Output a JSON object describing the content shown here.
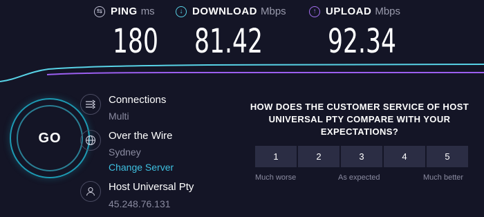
{
  "metrics": {
    "ping": {
      "name": "PING",
      "unit": "ms",
      "value": "180",
      "icon": "ping-icon",
      "color": "#bdbdd0"
    },
    "download": {
      "name": "DOWNLOAD",
      "unit": "Mbps",
      "value": "81.42",
      "icon": "download-arrow-icon",
      "color": "#58d2e6"
    },
    "upload": {
      "name": "UPLOAD",
      "unit": "Mbps",
      "value": "92.34",
      "icon": "upload-arrow-icon",
      "color": "#a46ff0"
    }
  },
  "graph": {
    "download_color": "#58d2e6",
    "upload_color": "#9b5ff0"
  },
  "go_button": {
    "label": "GO",
    "ring_color": "#1d9bb4"
  },
  "connections": {
    "title": "Connections",
    "value": "Multi",
    "icon": "connections-icon"
  },
  "server": {
    "title": "Over the Wire",
    "location": "Sydney",
    "change_label": "Change Server",
    "icon": "globe-icon"
  },
  "provider": {
    "title": "Host Universal Pty",
    "ip": "45.248.76.131",
    "icon": "user-icon"
  },
  "survey": {
    "question": "HOW DOES THE CUSTOMER SERVICE OF HOST UNIVERSAL PTY COMPARE WITH YOUR EXPECTATIONS?",
    "options": [
      "1",
      "2",
      "3",
      "4",
      "5"
    ],
    "low_label": "Much worse",
    "mid_label": "As expected",
    "high_label": "Much better"
  }
}
